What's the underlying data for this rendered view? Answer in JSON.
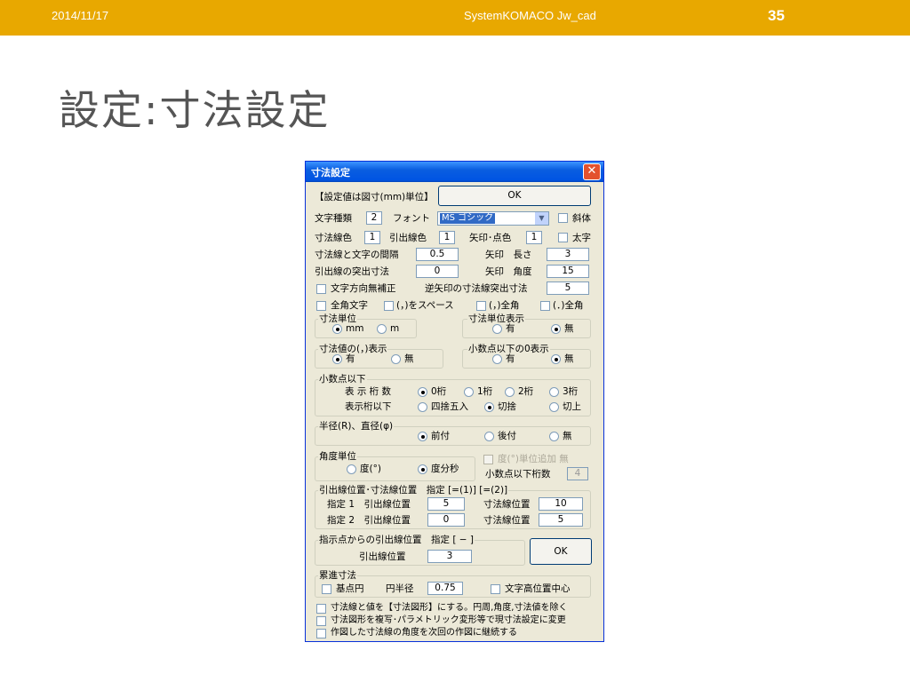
{
  "header": {
    "date": "2014/11/17",
    "title": "SystemKOMACO Jw_cad",
    "page": "35",
    "color": "#e8a800"
  },
  "slide_title": "設定:寸法設定",
  "dialog": {
    "title": "寸法設定",
    "close_glyph": "✕",
    "note": "【設定値は図寸(mm)単位】",
    "ok_label": "OK",
    "char_type_label": "文字種類",
    "char_type_value": "2",
    "font_label": "フォント",
    "font_value": "MS ゴシック",
    "italic_label": "斜体",
    "dim_line_color_label": "寸法線色",
    "dim_line_color_value": "1",
    "ext_line_color_label": "引出線色",
    "ext_line_color_value": "1",
    "arrow_color_label": "矢印･点色",
    "arrow_color_value": "1",
    "bold_label": "太字",
    "gap_label": "寸法線と文字の間隔",
    "gap_value": "0.5",
    "arrow_len_label": "矢印　長さ",
    "arrow_len_value": "3",
    "ext_overshoot_label": "引出線の突出寸法",
    "ext_overshoot_value": "0",
    "arrow_angle_label": "矢印　角度",
    "arrow_angle_value": "15",
    "no_dir_label": "文字方向無補正",
    "rev_arrow_label": "逆矢印の寸法線突出寸法",
    "rev_arrow_value": "5",
    "fullwidth_label": "全角文字",
    "comma_space_label": "(，)をスペース",
    "comma_full_label": "(，)全角",
    "period_full_label": "(．)全角",
    "unit_group": "寸法単位",
    "unit_mm": "mm",
    "unit_m": "m",
    "unit_disp_group": "寸法単位表示",
    "yes": "有",
    "no": "無",
    "comma_group": "寸法値の(，)表示",
    "zero_group": "小数点以下の0表示",
    "decimal_group": "小数点以下",
    "digits_label": "表 示 桁 数",
    "digit0": "0桁",
    "digit1": "1桁",
    "digit2": "2桁",
    "digit3": "3桁",
    "round_label": "表示桁以下",
    "round_half": "四捨五入",
    "round_down": "切捨",
    "round_up": "切上",
    "radius_group": "半径(R)、直径(φ)",
    "prefix": "前付",
    "suffix": "後付",
    "angle_group": "角度単位",
    "degree": "度(°)",
    "dms": "度分秒",
    "deg_unit_add_label": "度(°)単位追加 無",
    "decimal_digits_label": "小数点以下桁数",
    "decimal_digits_value": "4",
    "pos_group": "引出線位置･寸法線位置　指定 [=(1)] [=(2)]",
    "spec1_label": "指定 1　引出線位置",
    "spec1_ext_value": "5",
    "spec1_dim_label": "寸法線位置",
    "spec1_dim_value": "10",
    "spec2_label": "指定 2　引出線位置",
    "spec2_ext_value": "0",
    "spec2_dim_label": "寸法線位置",
    "spec2_dim_value": "5",
    "point_group": "指示点からの引出線位置　指定 [ − ]",
    "point_ext_label": "引出線位置",
    "point_ext_value": "3",
    "cum_group": "累進寸法",
    "base_circle_label": "基点円",
    "circle_radius_label": "円半径",
    "circle_radius_value": "0.75",
    "text_center_label": "文字高位置中心",
    "opt1": "寸法線と値を【寸法図形】にする。円周,角度,寸法値を除く",
    "opt2": "寸法図形を複写･パラメトリック変形等で現寸法設定に変更",
    "opt3": "作図した寸法線の角度を次回の作図に継続する"
  }
}
